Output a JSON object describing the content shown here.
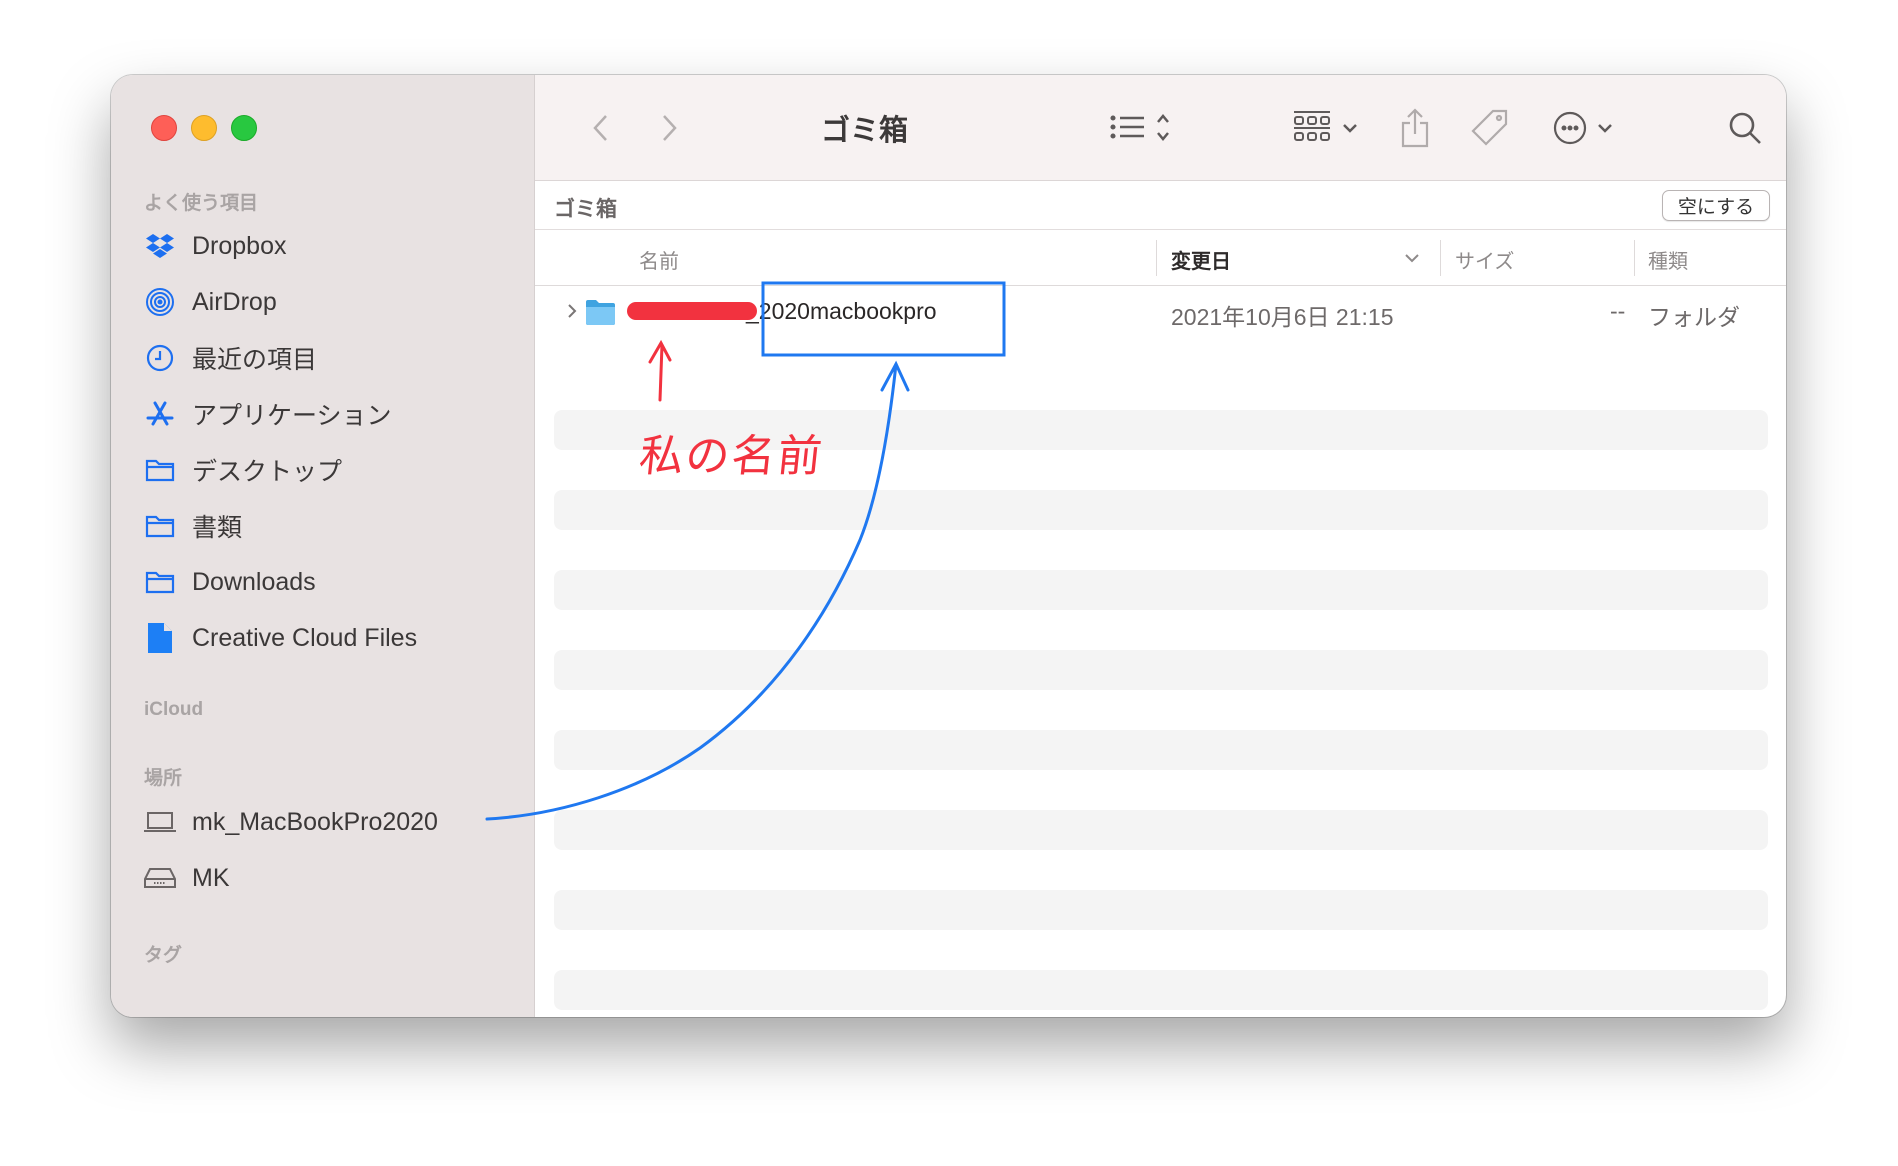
{
  "window": {
    "title": "ゴミ箱",
    "traffic_lights": {
      "close": "#fe5f57",
      "minimize": "#febc2e",
      "zoom": "#28c840"
    }
  },
  "sidebar": {
    "favorites_heading": "よく使う項目",
    "favorites": [
      {
        "label": "Dropbox",
        "icon": "dropbox-icon"
      },
      {
        "label": "AirDrop",
        "icon": "airdrop-icon"
      },
      {
        "label": "最近の項目",
        "icon": "clock-icon"
      },
      {
        "label": "アプリケーション",
        "icon": "applications-icon"
      },
      {
        "label": "デスクトップ",
        "icon": "folder-icon"
      },
      {
        "label": "書類",
        "icon": "folder-icon"
      },
      {
        "label": "Downloads",
        "icon": "folder-icon"
      },
      {
        "label": "Creative Cloud Files",
        "icon": "document-icon"
      }
    ],
    "icloud_heading": "iCloud",
    "locations_heading": "場所",
    "locations": [
      {
        "label": "mk_MacBookPro2020",
        "icon": "laptop-icon"
      },
      {
        "label": "MK",
        "icon": "external-drive-icon"
      }
    ],
    "tags_heading": "タグ"
  },
  "toolbar": {
    "title": "ゴミ箱"
  },
  "pathbar": {
    "title": "ゴミ箱",
    "empty_button": "空にする"
  },
  "columns": {
    "name": "名前",
    "modified": "変更日",
    "size": "サイズ",
    "kind": "種類"
  },
  "files": [
    {
      "name_visible": "_2020macbookpro",
      "modified": "2021年10月6日 21:15",
      "size": "--",
      "kind": "フォルダ"
    }
  ],
  "annotation": {
    "handwritten_label": "私の名前",
    "accent_red": "#f2323f",
    "accent_blue": "#1f78f0"
  }
}
